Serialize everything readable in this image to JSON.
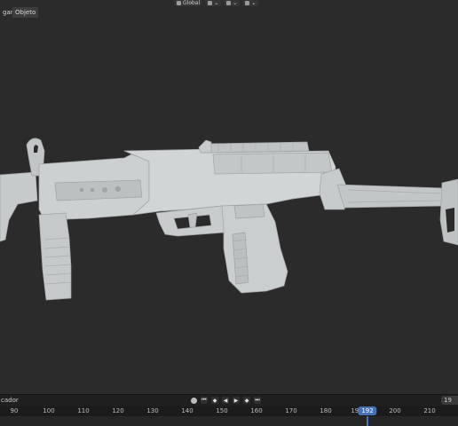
{
  "header": {
    "menu_1": "gar",
    "menu_2": "Objeto",
    "orientation_label": "Global"
  },
  "timeline": {
    "left_label": "cador",
    "frame_partial": "19",
    "current_frame": "192",
    "ticks": [
      "90",
      "100",
      "110",
      "120",
      "130",
      "140",
      "150",
      "160",
      "170",
      "180",
      "190",
      "200",
      "210"
    ]
  },
  "colors": {
    "viewport_bg": "#2b2b2b",
    "model": "#c9cccd",
    "accent": "#4772b3"
  },
  "icons": [
    "transform-orientation-icon",
    "pivot-icon",
    "snap-icon",
    "proportional-edit-icon",
    "record-icon",
    "jump-start-icon",
    "prev-keyframe-icon",
    "play-reverse-icon",
    "play-icon",
    "next-keyframe-icon",
    "jump-end-icon"
  ]
}
